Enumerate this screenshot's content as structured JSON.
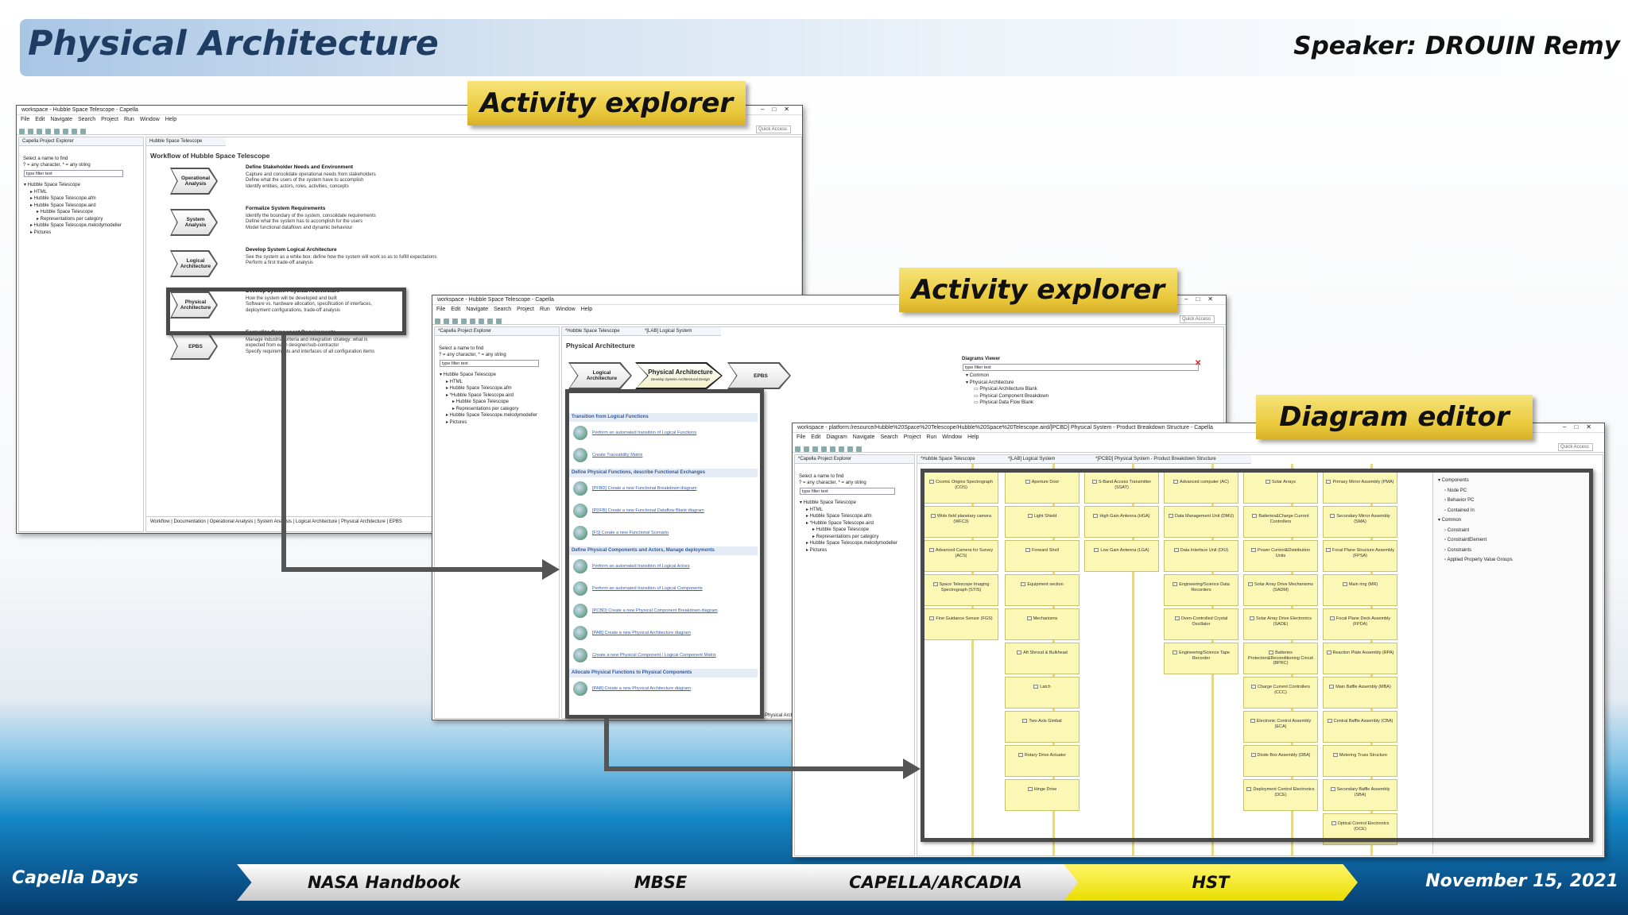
{
  "slide": {
    "title": "Physical Architecture",
    "speaker": "Speaker: DROUIN Remy",
    "footer_left": "Capella Days",
    "footer_right": "November 15, 2021",
    "breadcrumbs": [
      {
        "label": "NASA Handbook",
        "active": false
      },
      {
        "label": "MBSE",
        "active": false
      },
      {
        "label": "CAPELLA/ARCADIA",
        "active": false
      },
      {
        "label": "HST",
        "active": true
      }
    ]
  },
  "callouts": {
    "activity1": "Activity explorer",
    "activity2": "Activity explorer",
    "diagram": "Diagram editor"
  },
  "window1": {
    "title": "workspace - Hubble Space Telescope - Capella",
    "menu": [
      "File",
      "Edit",
      "Navigate",
      "Search",
      "Project",
      "Run",
      "Window",
      "Help"
    ],
    "quick_access": "Quick Access",
    "explorer_tab": "Capella Project Explorer",
    "filter_hint1": "Select a name to find",
    "filter_hint2": "? = any character, * = any string",
    "filter_placeholder": "type filter text",
    "tree": [
      "Hubble Space Telescope",
      "HTML",
      "Hubble Space Telescope.afm",
      "Hubble Space Telescope.aird",
      "Hubble Space Telescope",
      "Representations per category",
      "Hubble Space Telescope.melodymodeller",
      "Pictures"
    ],
    "editor_tab": "Hubble Space Telescope",
    "workflow_title": "Workflow of Hubble Space Telescope",
    "steps": [
      {
        "chevron": "Operational Analysis",
        "title": "Define Stakeholder Needs and Environment",
        "lines": [
          "Capture and consolidate operational needs from stakeholders",
          "Define what the users of the system have to accomplish",
          "Identify entities, actors, roles, activities, concepts"
        ]
      },
      {
        "chevron": "System Analysis",
        "title": "Formalize System Requirements",
        "lines": [
          "Identify the boundary of the system, consolidate requirements",
          "Define what the system has to accomplish for the users",
          "Model functional dataflows and dynamic behaviour"
        ]
      },
      {
        "chevron": "Logical Architecture",
        "title": "Develop System Logical Architecture",
        "lines": [
          "See the system as a white box: define how the system will work so as to fulfill expectations",
          "Perform a first trade-off analysis"
        ]
      },
      {
        "chevron": "Physical Architecture",
        "title": "Develop System Physical Architecture",
        "lines": [
          "How the system will be developed and built",
          "Software vs. hardware allocation, specification of interfaces,",
          "deployment configurations, trade-off analysis"
        ]
      },
      {
        "chevron": "EPBS",
        "title": "Formalize Component Requirements",
        "lines": [
          "Manage industrial criteria and integration strategy: what is",
          "expected from each designer/sub-contractor",
          "Specify requirements and interfaces of all configuration items"
        ]
      }
    ],
    "bottom_tabs": "Workflow | Documentation | Operational Analysis | System Analysis | Logical Architecture | Physical Architecture | EPBS"
  },
  "window2": {
    "title": "workspace - Hubble Space Telescope - Capella",
    "menu": [
      "File",
      "Edit",
      "Navigate",
      "Search",
      "Project",
      "Run",
      "Window",
      "Help"
    ],
    "quick_access": "Quick Access",
    "explorer_tab": "*Capella Project Explorer",
    "filter_hint1": "Select a name to find",
    "filter_hint2": "? = any character, * = any string",
    "filter_placeholder": "type filter text",
    "tree": [
      "Hubble Space Telescope",
      "HTML",
      "Hubble Space Telescope.afm",
      "*Hubble Space Telescope.aird",
      "Hubble Space Telescope",
      "Representations per category",
      "Hubble Space Telescope.melodymodeller",
      "Pictures"
    ],
    "editor_tab1": "*Hubble Space Telescope",
    "editor_tab2": "*[LAB] Logical System",
    "page_title": "Physical Architecture",
    "chevrons": [
      "Logical Architecture",
      "Physical Architecture",
      "EPBS"
    ],
    "chevron_sub": "Develop System Architectural Design",
    "viewer_title": "Diagrams Viewer",
    "viewer_filter": "type filter text",
    "viewer_tree": [
      "Common",
      "Physical Architecture",
      "Physical Architecture Blank",
      "Physical Component Breakdown",
      "Physical Data Flow Blank"
    ],
    "side_label": "Physical Arch",
    "sections": [
      {
        "title": "Transition from Logical Functions",
        "items": [
          "Perform an automated transition of Logical Functions",
          "Create Traceability Matrix"
        ]
      },
      {
        "title": "Define Physical Functions, describe Functional Exchanges",
        "items": [
          "[PFBD] Create a new Functional Breakdown diagram",
          "[PDFB] Create a new Functional Dataflow Blank diagram",
          "[FS] Create a new Functional Scenario"
        ]
      },
      {
        "title": "Define Physical Components and Actors, Manage deployments",
        "items": [
          "Perform an automated transition of Logical Actors",
          "Perform an automated transition of Logical Components",
          "[PCBD] Create a new Physical Component Breakdown diagram",
          "[PAB] Create a new Physical Architecture diagram",
          "Create a new Physical Component / Logical Component Matrix"
        ]
      },
      {
        "title": "Allocate Physical Functions to Physical Components",
        "items": [
          "[PAB] Create a new Physical Architecture diagram"
        ]
      }
    ]
  },
  "window3": {
    "title": "workspace - platform:/resource/Hubble%20Space%20Telescope/Hubble%20Space%20Telescope.aird/[PCBD] Physical System - Product Breakdown Structure - Capella",
    "menu": [
      "File",
      "Edit",
      "Diagram",
      "Navigate",
      "Search",
      "Project",
      "Run",
      "Window",
      "Help"
    ],
    "quick_access": "Quick Access",
    "explorer_tab": "*Capella Project Explorer",
    "filter_hint1": "Select a name to find",
    "filter_hint2": "? = any character, * = any string",
    "filter_placeholder": "type filter text",
    "tree": [
      "Hubble Space Telescope",
      "HTML",
      "Hubble Space Telescope.afm",
      "*Hubble Space Telescope.aird",
      "Hubble Space Telescope",
      "Representations per category",
      "Hubble Space Telescope.melodymodeller",
      "Pictures"
    ],
    "editor_tabs": [
      "*Hubble Space Telescope",
      "*[LAB] Logical System",
      "*[PCBD] Physical System - Product Breakdown Structure"
    ],
    "palette": [
      "Components",
      "Node PC",
      "Behavior PC",
      "Contained In",
      "Common",
      "Constraint",
      "ConstraintElement",
      "Constraints",
      "Applied Property Value Groups"
    ],
    "columns": [
      [
        "Cosmic Origins Spectrograph (COS)",
        "Wide field planetary camera (WFC3)",
        "Advanced Camera for Survey (ACS)",
        "Space Telescope Imaging Spectrograph (STIS)",
        "Fine Guidance Sensor (FGS)"
      ],
      [
        "Aperture Door",
        "Light Shield",
        "Forward Shell",
        "Equipment section",
        "Mechanisms",
        "Aft Shroud & Bulkhead",
        "Latch",
        "Two-Axis Gimbal",
        "Rotary Drive Actuator",
        "Hinge Drive"
      ],
      [
        "S-Band Access Transmitter (SSAT)",
        "High Gain Antenna (HGA)",
        "Low Gain Antenna (LGA)"
      ],
      [
        "Advanced computer (AC)",
        "Data Management Unit (DMU)",
        "Data Interface Unit (DIU)",
        "Engineering/Science Data Recorders",
        "Oven-Controlled Crystal Oscillator",
        "Engineering/Science Tape Recorder"
      ],
      [
        "Solar Arrays",
        "Batteries&Charge Current Controllers",
        "Power Control&Distribution Units",
        "Solar Array Drive Mechanisms (SADM)",
        "Solar Array Drive Electronics (SADE)",
        "Batteries Protection&Reconditioning Circuit (BPRC)",
        "Charge Current Controllers (CCC)",
        "Electronic Control Assembly (ECA)",
        "Diode Box Assembly (DBA)",
        "Deployment Control Electronics (DCE)"
      ],
      [
        "Primary Mirror Assembly (PMA)",
        "Secondary Mirror Assembly (SMA)",
        "Focal Plane Structure Assembly (FPSA)",
        "Main ring (MR)",
        "Focal Plane Deck Assembly (FPDA)",
        "Reaction Plate Assembly (RPA)",
        "Main Baffle Assembly (MBA)",
        "Central Baffle Assembly (CBA)",
        "Metering Truss Structure",
        "Secondary Baffle Assembly (SBA)",
        "Optical Control Electronics (OCE)"
      ]
    ]
  }
}
